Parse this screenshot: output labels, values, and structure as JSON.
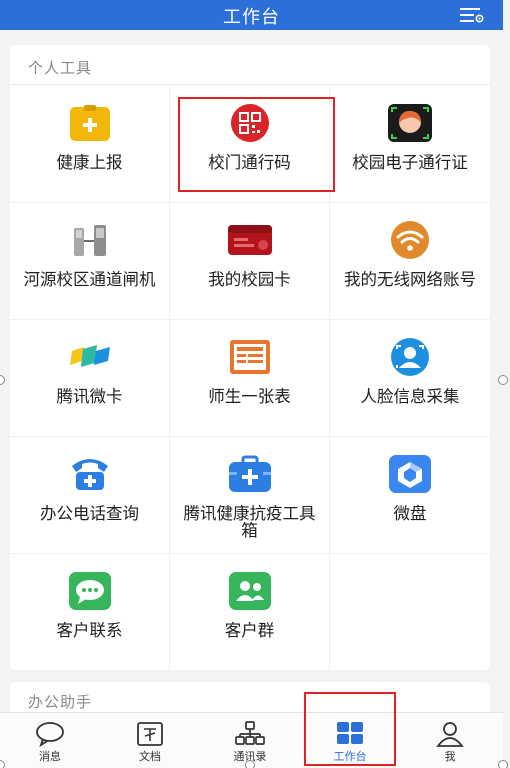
{
  "header": {
    "title": "工作台",
    "settings_icon": "list-settings-icon"
  },
  "sections": {
    "personal_tools": "个人工具",
    "office_assistant": "办公助手"
  },
  "tools": [
    {
      "label": "健康上报",
      "icon": "health-report-icon",
      "color": "#f2b70a"
    },
    {
      "label": "校门通行码",
      "icon": "qr-code-icon",
      "color": "#d9252a"
    },
    {
      "label": "校园电子通行证",
      "icon": "face-pass-icon",
      "color": "#e46a3a"
    },
    {
      "label": "河源校区通道闸机",
      "icon": "turnstile-gate-icon",
      "color": "#9a9a9a"
    },
    {
      "label": "我的校园卡",
      "icon": "campus-card-icon",
      "color": "#b3141c"
    },
    {
      "label": "我的无线网络账号",
      "icon": "wifi-icon",
      "color": "#e08a2b"
    },
    {
      "label": "腾讯微卡",
      "icon": "tencent-weika-icon",
      "color": "#2fb8a3"
    },
    {
      "label": "师生一张表",
      "icon": "form-table-icon",
      "color": "#e9742b"
    },
    {
      "label": "人脸信息采集",
      "icon": "face-collect-icon",
      "color": "#1e8fe0"
    },
    {
      "label": "办公电话查询",
      "icon": "telephone-icon",
      "color": "#2c7ee3"
    },
    {
      "label": "腾讯健康抗疫工具箱",
      "icon": "medical-kit-icon",
      "color": "#2c7ee3"
    },
    {
      "label": "微盘",
      "icon": "cloud-disk-icon",
      "color": "#3a86f0"
    },
    {
      "label": "客户联系",
      "icon": "chat-bubble-icon",
      "color": "#36b55a"
    },
    {
      "label": "客户群",
      "icon": "group-contacts-icon",
      "color": "#36b55a"
    }
  ],
  "tabs": [
    {
      "label": "消息",
      "icon": "message-icon"
    },
    {
      "label": "文档",
      "icon": "document-icon"
    },
    {
      "label": "通讯录",
      "icon": "contacts-icon"
    },
    {
      "label": "工作台",
      "icon": "workbench-icon",
      "active": true
    },
    {
      "label": "我",
      "icon": "profile-icon"
    }
  ],
  "colors": {
    "brand": "#2d6fd9",
    "highlight": "#e02222"
  }
}
